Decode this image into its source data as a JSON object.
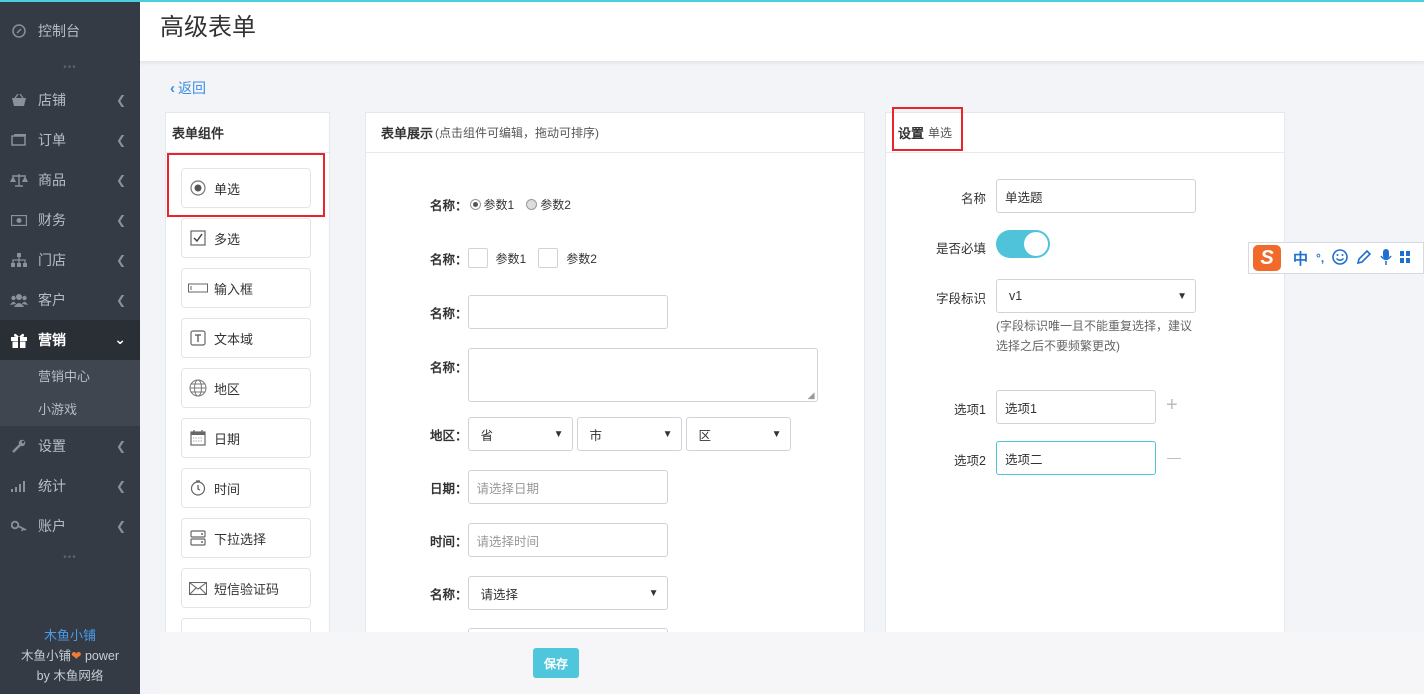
{
  "sidebar": {
    "items": [
      {
        "label": "控制台",
        "icon": "dashboard-icon"
      },
      {
        "label": "店铺",
        "icon": "store-icon"
      },
      {
        "label": "订单",
        "icon": "order-icon"
      },
      {
        "label": "商品",
        "icon": "scale-icon"
      },
      {
        "label": "财务",
        "icon": "money-icon"
      },
      {
        "label": "门店",
        "icon": "sitemap-icon"
      },
      {
        "label": "客户",
        "icon": "users-icon"
      },
      {
        "label": "营销",
        "icon": "gift-icon"
      },
      {
        "label": "设置",
        "icon": "wrench-icon"
      },
      {
        "label": "统计",
        "icon": "bar-signal-icon"
      },
      {
        "label": "账户",
        "icon": "key-icon"
      }
    ],
    "sub_items": [
      "营销中心",
      "小游戏"
    ],
    "brand": {
      "name": "木鱼小铺",
      "line2": "木鱼小铺",
      "power": "power",
      "line3_by": "by",
      "line3_company": "木鱼网络"
    }
  },
  "header": {
    "title": "高级表单"
  },
  "back": {
    "label": "返回"
  },
  "components": {
    "title": "表单组件",
    "items": [
      {
        "label": "单选",
        "icon": "radio-icon"
      },
      {
        "label": "多选",
        "icon": "checkbox-icon"
      },
      {
        "label": "输入框",
        "icon": "input-icon"
      },
      {
        "label": "文本域",
        "icon": "textarea-icon"
      },
      {
        "label": "地区",
        "icon": "globe-icon"
      },
      {
        "label": "日期",
        "icon": "calendar-icon"
      },
      {
        "label": "时间",
        "icon": "clock-icon"
      },
      {
        "label": "下拉选择",
        "icon": "dropdown-icon"
      },
      {
        "label": "短信验证码",
        "icon": "envelope-icon"
      }
    ]
  },
  "preview": {
    "title": "表单展示",
    "hint": "(点击组件可编辑，拖动可排序)",
    "name_label": "名称：",
    "param1": "参数1",
    "param2": "参数2",
    "region_label": "地区：",
    "province": "省",
    "city": "市",
    "district": "区",
    "date_label": "日期：",
    "date_placeholder": "请选择日期",
    "time_label": "时间：",
    "time_placeholder": "请选择时间",
    "select_value": "请选择"
  },
  "settings": {
    "title": "设置",
    "subtitle": "单选",
    "name_label": "名称",
    "name_value": "单选题",
    "required_label": "是否必填",
    "required_on": true,
    "field_label": "字段标识",
    "field_value": "v1",
    "field_note_1": "(字段标识唯一且不能重复选择，建议",
    "field_note_2": "选择之后不要频繁更改)",
    "option1_label": "选项1",
    "option1_value": "选项1",
    "option2_label": "选项2",
    "option2_value": "选项二",
    "add_symbol": "+",
    "remove_symbol": "—"
  },
  "footer": {
    "save_label": "保存"
  },
  "ime": {
    "logo": "S",
    "lang": "中",
    "punct": "°,"
  }
}
